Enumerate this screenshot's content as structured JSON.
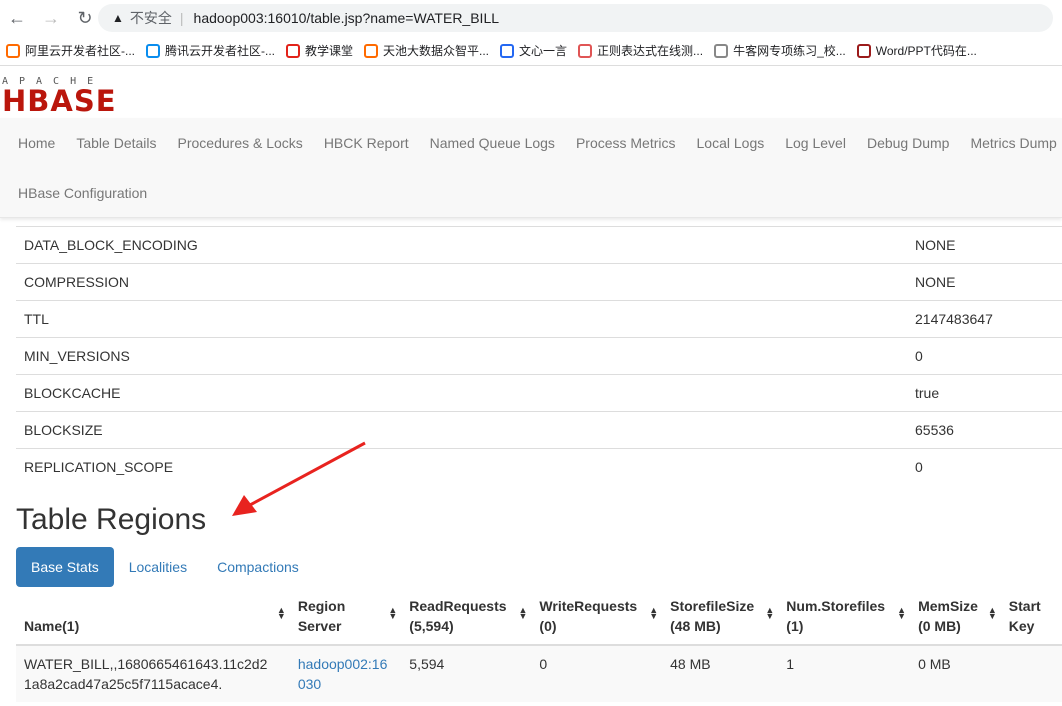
{
  "browser": {
    "security": "不安全",
    "url": "hadoop003:16010/table.jsp?name=WATER_BILL"
  },
  "bookmarks": [
    {
      "label": "阿里云开发者社区-...",
      "icon": "aliyun-icon",
      "color": "#ff6a00"
    },
    {
      "label": "腾讯云开发者社区-...",
      "icon": "tencent-cloud-icon",
      "color": "#0a8dee"
    },
    {
      "label": "教学课堂",
      "icon": "toutiao-icon",
      "color": "#e2231a"
    },
    {
      "label": "天池大数据众智平...",
      "icon": "tianchi-icon",
      "color": "#ff6a00"
    },
    {
      "label": "文心一言",
      "icon": "wenxin-icon",
      "color": "#2468f2"
    },
    {
      "label": "正则表达式在线测...",
      "icon": "regex-icon",
      "color": "#e05555"
    },
    {
      "label": "牛客网专项练习_校...",
      "icon": "nowcoder-icon",
      "color": "#888"
    },
    {
      "label": "Word/PPT代码在...",
      "icon": "word-ppt-icon",
      "color": "#9b1b1b"
    }
  ],
  "logo": {
    "top": "APACHE",
    "main": "HBASE"
  },
  "nav": [
    "Home",
    "Table Details",
    "Procedures & Locks",
    "HBCK Report",
    "Named Queue Logs",
    "Process Metrics",
    "Local Logs",
    "Log Level",
    "Debug Dump",
    "Metrics Dump",
    "HBase Configuration"
  ],
  "properties": [
    {
      "name": "DATA_BLOCK_ENCODING",
      "value": "NONE"
    },
    {
      "name": "COMPRESSION",
      "value": "NONE"
    },
    {
      "name": "TTL",
      "value": "2147483647"
    },
    {
      "name": "MIN_VERSIONS",
      "value": "0"
    },
    {
      "name": "BLOCKCACHE",
      "value": "true"
    },
    {
      "name": "BLOCKSIZE",
      "value": "65536"
    },
    {
      "name": "REPLICATION_SCOPE",
      "value": "0"
    }
  ],
  "regions": {
    "title": "Table Regions",
    "tabs": [
      "Base Stats",
      "Localities",
      "Compactions"
    ],
    "headers": [
      [
        "Name(1)",
        ""
      ],
      [
        "Region",
        "Server"
      ],
      [
        "ReadRequests",
        "(5,594)"
      ],
      [
        "WriteRequests",
        "(0)"
      ],
      [
        "StorefileSize",
        "(48 MB)"
      ],
      [
        "Num.Storefiles",
        "(1)"
      ],
      [
        "MemSize",
        "(0 MB)"
      ],
      [
        "Start",
        "Key"
      ]
    ],
    "rows": [
      {
        "name1": "WATER_BILL,,1680665461643.11c2d2",
        "name2": "1a8a2cad47a25c5f7115acace4.",
        "server1": "hadoop002:16",
        "server2": "030",
        "read": "5,594",
        "write": "0",
        "size": "48 MB",
        "files": "1",
        "mem": "0 MB",
        "start": ""
      }
    ]
  },
  "annotation": {
    "arrow_color": "#e8231f"
  }
}
